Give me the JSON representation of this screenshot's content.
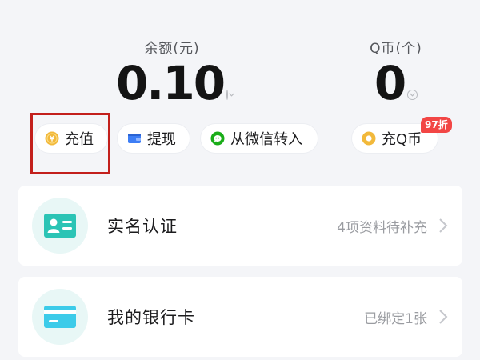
{
  "balance": {
    "label": "余额(元)",
    "amount": "0.10"
  },
  "qcoin": {
    "label": "Q币(个)",
    "amount": "0"
  },
  "actions": {
    "topup_label": "充值",
    "withdraw_label": "提现",
    "wechat_transfer_label": "从微信转入",
    "qcoin_topup_label": "充Q币",
    "qcoin_discount_badge": "97折"
  },
  "icons": {
    "topup": "coin-icon",
    "withdraw": "wallet-icon",
    "wechat_transfer": "wechat-icon",
    "qcoin_topup": "coin-icon",
    "identity": "id-card-icon",
    "bank": "bank-card-icon",
    "chevron": "chevron-right-icon"
  },
  "colors": {
    "coin": "#f2b93b",
    "wallet": "#3d7ef5",
    "wechat": "#1aad19",
    "accent_teal": "#2bc4b5",
    "badge_red": "#f24645",
    "highlight_red": "#c3201c"
  },
  "list": {
    "identity": {
      "title": "实名认证",
      "status": "4项资料待补充"
    },
    "bank_card": {
      "title": "我的银行卡",
      "status": "已绑定1张"
    }
  }
}
